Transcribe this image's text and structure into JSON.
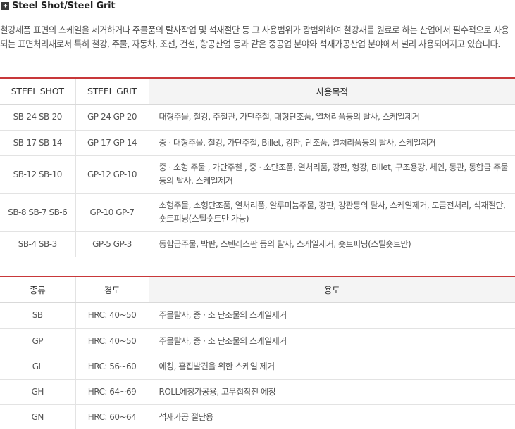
{
  "section": {
    "title": "Steel Shot/Steel Grit"
  },
  "intro": "철강제품 표면의 스케일을 제거하거나 주물품의 탈사작업 및 석재절단 등 그 사용범위가 광범위하여 철강재를 원료로 하는 산업에서 필수적으로 사용되는 표면처리재로서 특히 철강, 주물, 자동차, 조선, 건설, 항공산업 등과 같은 중공업 분야와 석재가공산업 분야에서 널리 사용되어지고 있습니다.",
  "shot_table": {
    "headers": [
      "STEEL SHOT",
      "STEEL GRIT",
      "사용목적"
    ],
    "rows": [
      {
        "shot": "SB-24 SB-20",
        "grit": "GP-24 GP-20",
        "purpose": "대형주물, 철강, 주철관, 가단주철, 대형단조품, 열처리품등의 탈사, 스케일제거"
      },
      {
        "shot": "SB-17 SB-14",
        "grit": "GP-17 GP-14",
        "purpose": "중 · 대형주물, 철강, 가단주철, Billet, 강판, 단조품, 열처리품등의 탈사, 스케일제거"
      },
      {
        "shot": "SB-12 SB-10",
        "grit": "GP-12 GP-10",
        "purpose": "중 · 소형 주물 , 가단주철 , 중 · 소단조품, 열처리품, 강판, 형강, Billet, 구조용강, 체인, 동관, 동합금 주물 등의 탈사, 스케일제거"
      },
      {
        "shot": "SB-8 SB-7 SB-6",
        "grit": "GP-10 GP-7",
        "purpose": "소형주물, 소형단조품, 열처리품, 알루미늄주물, 강판, 강관등의 탈사, 스케일제거, 도금전처리, 석재절단, 숏트피닝(스틸숏트만 가능)"
      },
      {
        "shot": "SB-4 SB-3",
        "grit": "GP-5 GP-3",
        "purpose": "동합금주물, 박판, 스텐레스판 등의 탈사, 스케일제거, 숏트피닝(스틸숏트만)"
      }
    ]
  },
  "hardness_table": {
    "headers": [
      "종류",
      "경도",
      "용도"
    ],
    "rows": [
      {
        "type": "SB",
        "hardness": "HRC: 40~50",
        "usage": "주물탈사, 중 · 소 단조물의 스케일제거"
      },
      {
        "type": "GP",
        "hardness": "HRC: 40~50",
        "usage": "주물탈사, 중 · 소 단조물의 스케일제거"
      },
      {
        "type": "GL",
        "hardness": "HRC: 56~60",
        "usage": "에칭, 흠집발견을 위한 스케일 제거"
      },
      {
        "type": "GH",
        "hardness": "HRC: 64~69",
        "usage": "ROLL에칭가공용, 고무접착전 에칭"
      },
      {
        "type": "GN",
        "hardness": "HRC: 60~64",
        "usage": "석재가공 절단용"
      }
    ]
  },
  "colors": {
    "accent_border": "#c8383a",
    "header_highlight": "#f4f4f4",
    "text": "#555555"
  },
  "icons": {
    "title_marker": "plus-icon"
  }
}
